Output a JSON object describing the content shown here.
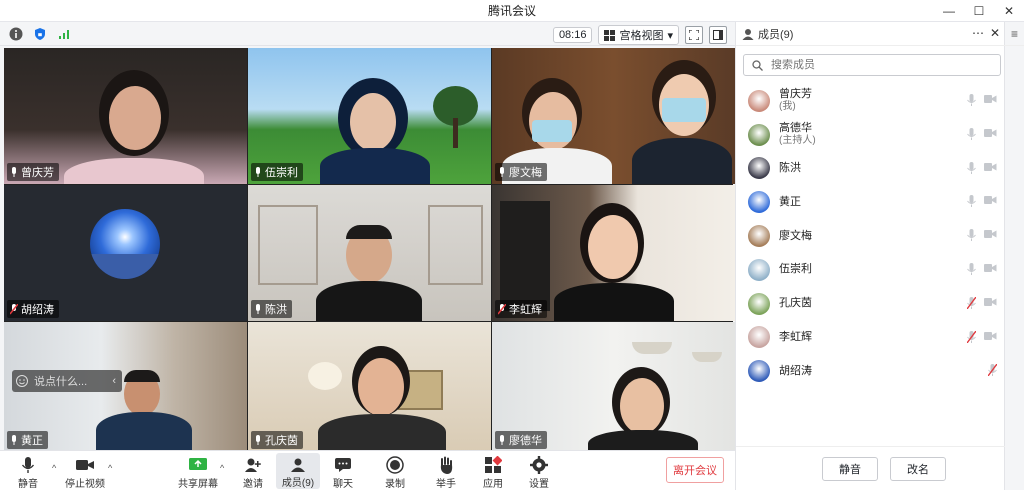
{
  "window": {
    "title": "腾讯会议"
  },
  "topbar": {
    "time": "08:16",
    "view_label": "宫格视图"
  },
  "participants_tiles": [
    {
      "name": "曾庆芳"
    },
    {
      "name": "伍崇利"
    },
    {
      "name": "廖文梅"
    },
    {
      "name": "胡绍涛"
    },
    {
      "name": "陈洪"
    },
    {
      "name": "李虹辉"
    },
    {
      "name": "黄正"
    },
    {
      "name": "孔庆茵"
    },
    {
      "name": "廖德华"
    }
  ],
  "chat": {
    "placeholder": "说点什么..."
  },
  "toolbar": {
    "mute": "静音",
    "stop_video": "停止视频",
    "share": "共享屏幕",
    "invite": "邀请",
    "members": "成员(9)",
    "chat": "聊天",
    "record": "录制",
    "raise_hand": "举手",
    "apps": "应用",
    "settings": "设置",
    "leave": "离开会议"
  },
  "panel": {
    "title": "成员(9)",
    "search_placeholder": "搜索成员",
    "members": [
      {
        "name": "曾庆芳",
        "sub": "(我)",
        "muted": false
      },
      {
        "name": "高德华",
        "sub": "(主持人)",
        "muted": false
      },
      {
        "name": "陈洪",
        "sub": "",
        "muted": false
      },
      {
        "name": "黄正",
        "sub": "",
        "muted": false
      },
      {
        "name": "廖文梅",
        "sub": "",
        "muted": false
      },
      {
        "name": "伍崇利",
        "sub": "",
        "muted": false
      },
      {
        "name": "孔庆茵",
        "sub": "",
        "muted": true
      },
      {
        "name": "李虹辉",
        "sub": "",
        "muted": true
      },
      {
        "name": "胡绍涛",
        "sub": "",
        "muted": true
      }
    ],
    "mute_all": "静音",
    "rename": "改名"
  },
  "colors": {
    "accent": "#0a6cff",
    "danger": "#e0393e",
    "secure": "#1a73e8",
    "signal": "#2fb344"
  }
}
